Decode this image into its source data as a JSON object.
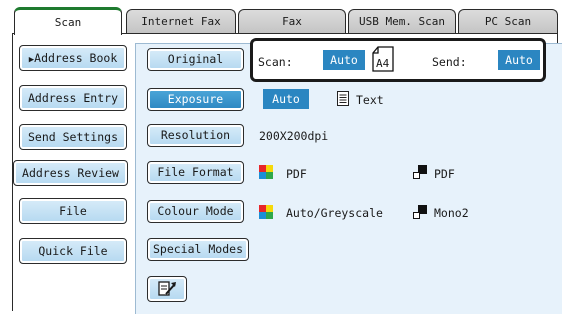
{
  "tabs": [
    {
      "label": "Scan",
      "active": true
    },
    {
      "label": "Internet Fax"
    },
    {
      "label": "Fax"
    },
    {
      "label": "USB Mem. Scan"
    },
    {
      "label": "PC Scan"
    }
  ],
  "left_menu": {
    "address_book": "Address Book",
    "address_entry": "Address Entry",
    "send_settings": "Send Settings",
    "address_review": "Address Review",
    "file": "File",
    "quick_file": "Quick File"
  },
  "original": {
    "button": "Original",
    "scan_label": "Scan:",
    "scan_value": "Auto",
    "paper_size": "A4",
    "send_label": "Send:",
    "send_value": "Auto"
  },
  "exposure": {
    "button": "Exposure",
    "mode": "Auto",
    "type": "Text"
  },
  "resolution": {
    "button": "Resolution",
    "value": "200X200dpi"
  },
  "file_format": {
    "button": "File Format",
    "colour": "PDF",
    "mono": "PDF"
  },
  "colour_mode": {
    "button": "Colour Mode",
    "colour": "Auto/Greyscale",
    "mono": "Mono2"
  },
  "special_modes": {
    "button": "Special Modes"
  },
  "icons": {
    "arrow_tab": "▶",
    "colour_icon": "colour-squares-icon",
    "mono_icon": "mono-squares-icon"
  },
  "colors": {
    "accent_blue": "#2b86c1",
    "light_blue": "#cfe6f6",
    "tab_green": "#1e7a2e"
  }
}
